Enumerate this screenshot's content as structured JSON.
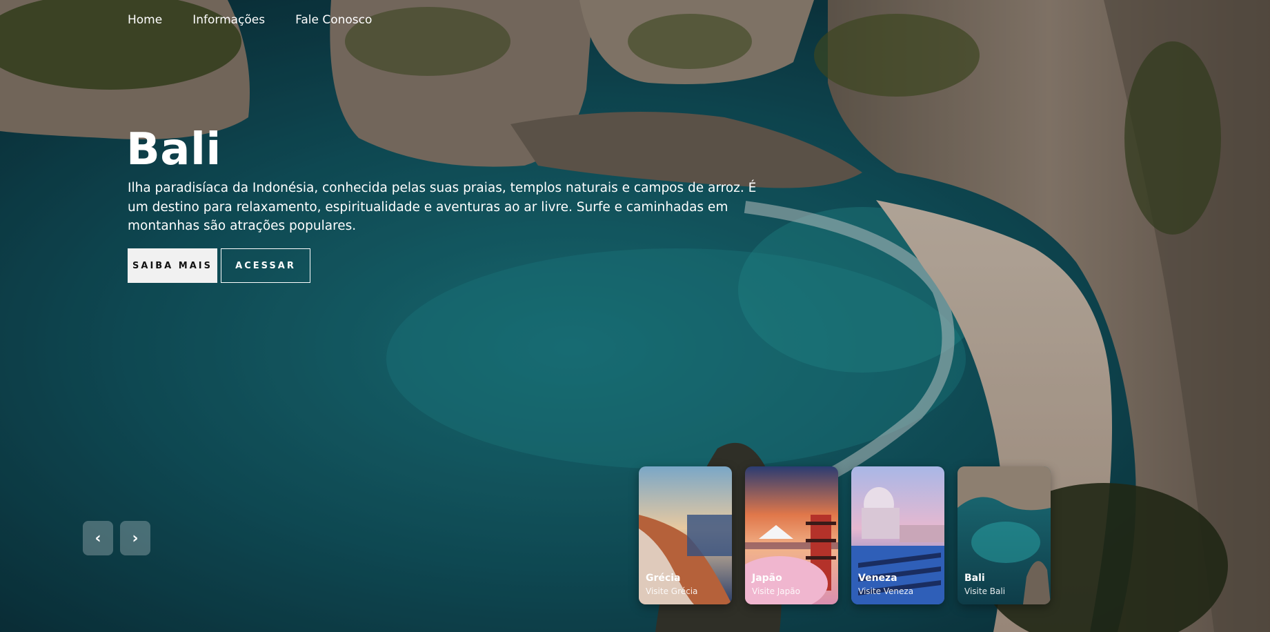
{
  "nav": {
    "items": [
      "Home",
      "Informações",
      "Fale Conosco"
    ]
  },
  "hero": {
    "title": "Bali",
    "description": "Ilha paradisíaca da Indonésia, conhecida pelas suas praias, templos naturais e campos de arroz. É um destino para relaxamento, espiritualidade e aventuras ao ar livre. Surfe e caminhadas em montanhas são atrações populares.",
    "primary_button": "SAIBA MAIS",
    "secondary_button": "ACESSAR"
  },
  "controls": {
    "prev_icon": "chevron-left-icon",
    "prev_glyph": "‹",
    "next_icon": "chevron-right-icon",
    "next_glyph": "›"
  },
  "cards": [
    {
      "title": "Grécia",
      "subtitle": "Visite Grécia"
    },
    {
      "title": "Japão",
      "subtitle": "Visite Japão"
    },
    {
      "title": "Veneza",
      "subtitle": "Visite Veneza"
    },
    {
      "title": "Bali",
      "subtitle": "Visite Bali"
    }
  ],
  "colors": {
    "sea": "#0f4a55",
    "cliff": "#8a7a6c",
    "sand": "#cdbfb0",
    "button_bg": "#f1f1f1"
  }
}
